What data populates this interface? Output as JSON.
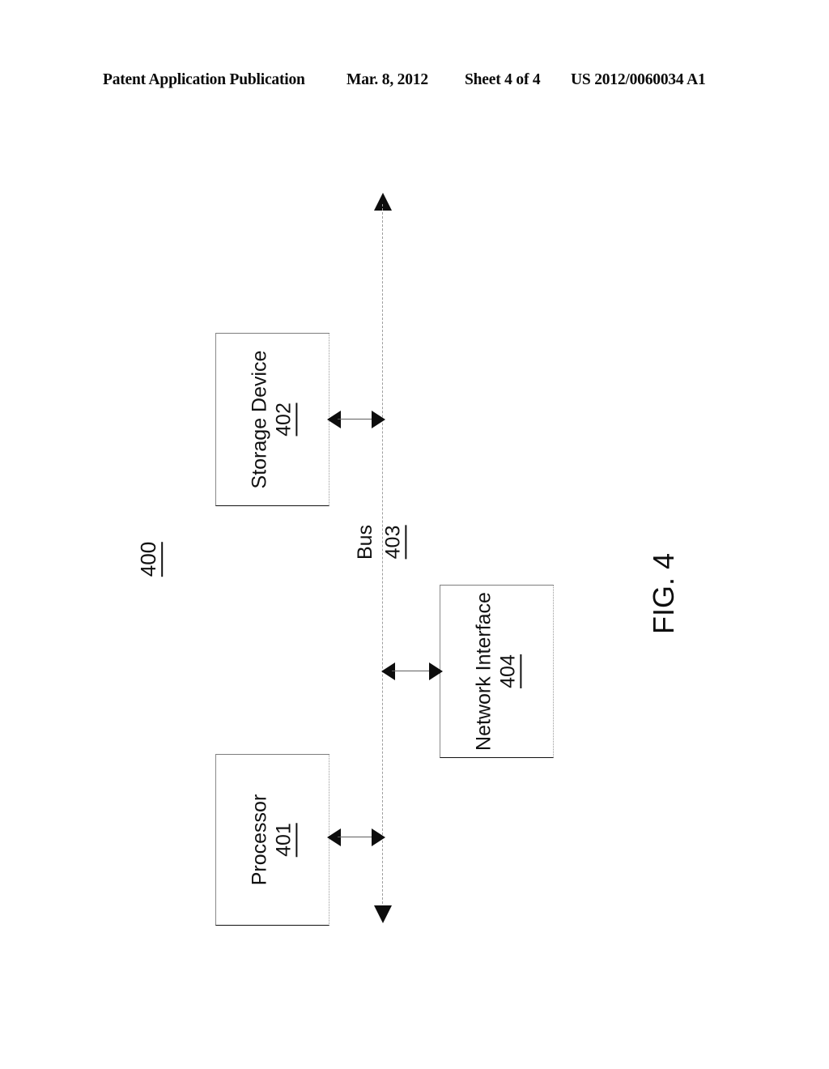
{
  "header": {
    "publication": "Patent Application Publication",
    "date": "Mar. 8, 2012",
    "sheet": "Sheet 4 of 4",
    "patent_number": "US 2012/0060034 A1"
  },
  "figure": {
    "caption": "FIG. 4",
    "assembly_ref": "400",
    "bus": {
      "label": "Bus",
      "ref": "403"
    },
    "blocks": [
      {
        "id": "storage",
        "title": "Storage Device",
        "ref": "402"
      },
      {
        "id": "processor",
        "title": "Processor",
        "ref": "401"
      },
      {
        "id": "netif",
        "title": "Network Interface",
        "ref": "404"
      }
    ],
    "connectors": [
      {
        "id": "conn-storage",
        "from": "Storage Device",
        "to": "Bus",
        "style": "double-arrow"
      },
      {
        "id": "conn-processor",
        "from": "Processor",
        "to": "Bus",
        "style": "double-arrow"
      },
      {
        "id": "conn-netif",
        "from": "Bus",
        "to": "Network Interface",
        "style": "double-arrow"
      }
    ]
  },
  "colors": {
    "ink": "#111111",
    "line_gray": "#9d9d9d",
    "page": "#ffffff"
  }
}
